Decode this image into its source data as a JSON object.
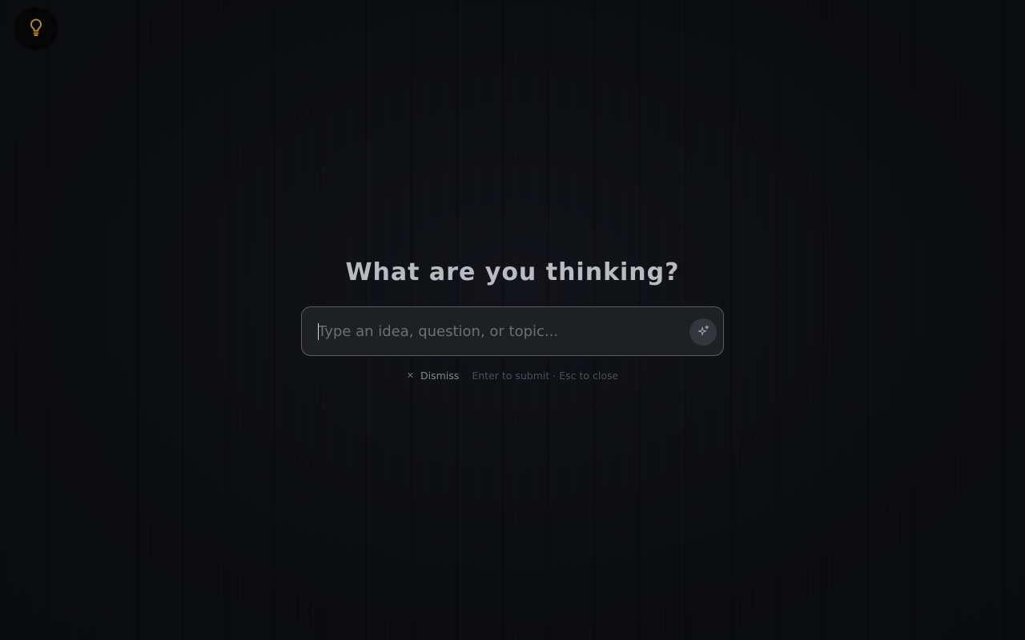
{
  "corner": {
    "icon": "lightbulb-icon",
    "accent_color": "#b8892a"
  },
  "prompt": {
    "title": "What are you thinking?",
    "input_value": "",
    "input_placeholder": "Type an idea, question, or topic...",
    "submit_icon": "sparkles-icon"
  },
  "hints": {
    "dismiss_icon": "close-icon",
    "dismiss_label": "Dismiss",
    "shortcut_text": "Enter to submit · Esc to close"
  }
}
